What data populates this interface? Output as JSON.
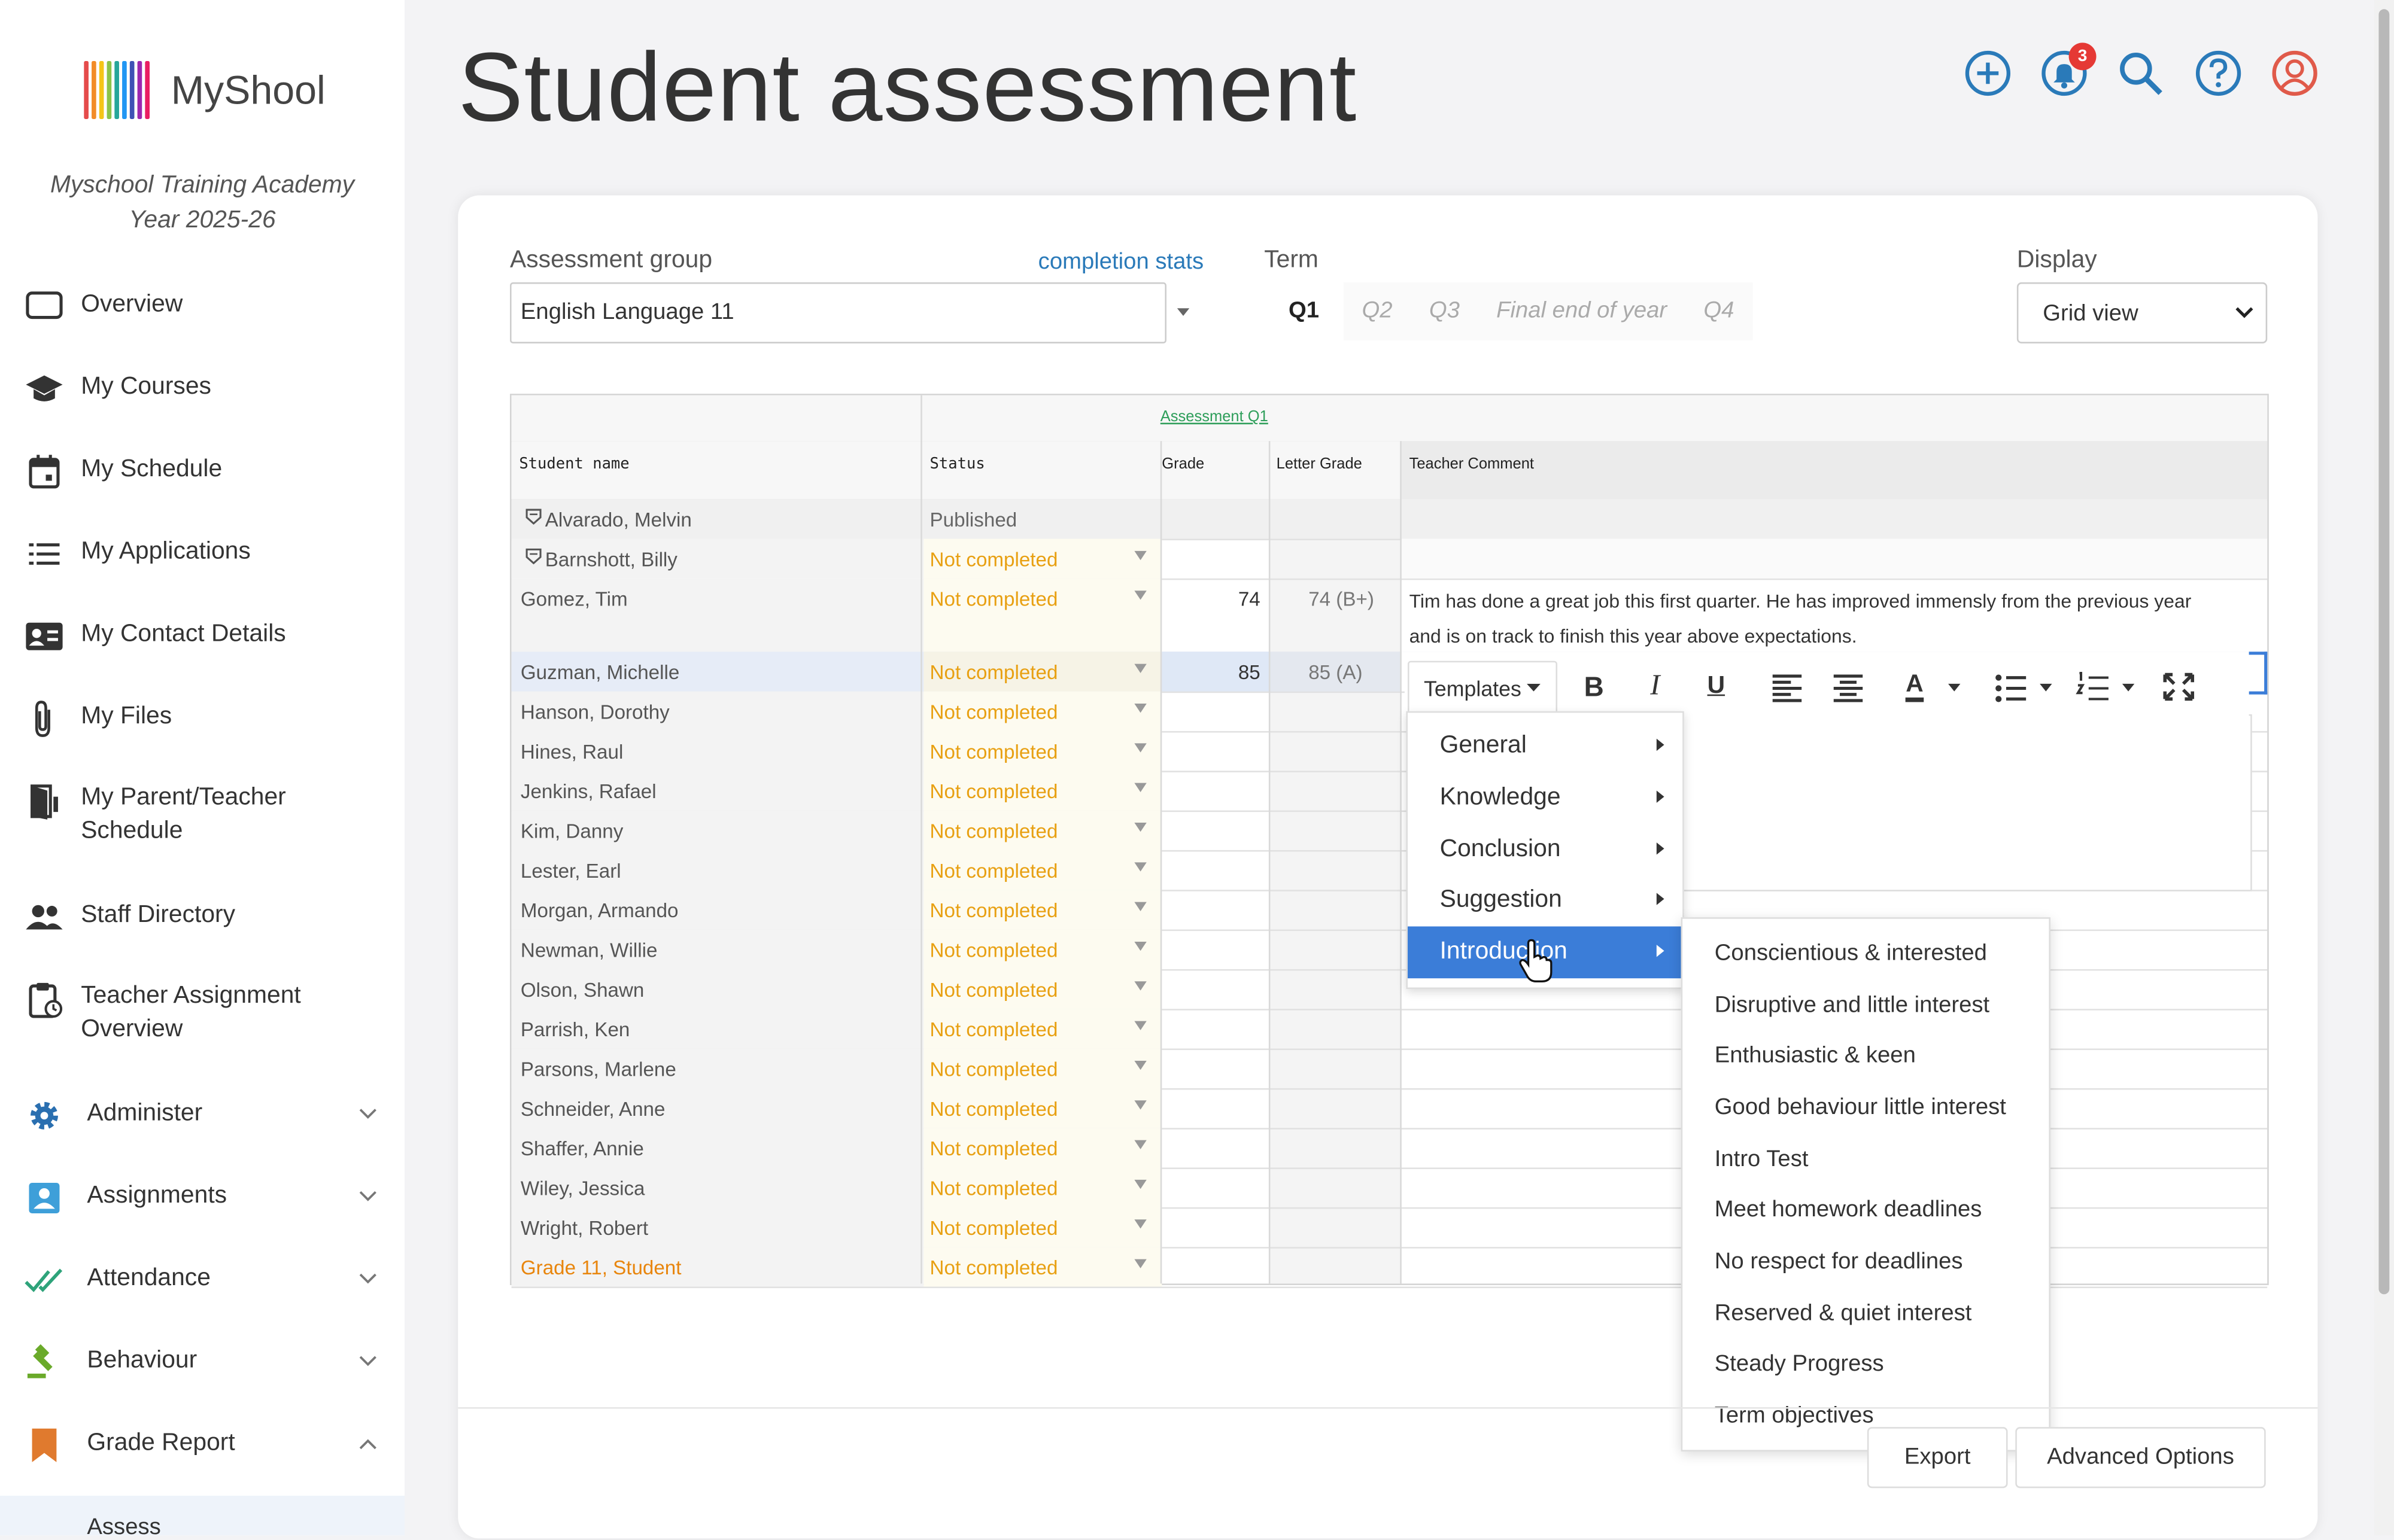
{
  "app": {
    "name": "MyShool",
    "school": "Myschool Training Academy",
    "year": "Year 2025-26"
  },
  "colors": {
    "accent": "#2a7ab9",
    "status": "#e8a012",
    "menu_active": "#3b7dd8",
    "badge": "#e53935",
    "orange_row": "#e8850c"
  },
  "sidebar": {
    "items": [
      {
        "label": "Overview",
        "icon": "monitor-icon"
      },
      {
        "label": "My Courses",
        "icon": "graduation-cap-icon"
      },
      {
        "label": "My Schedule",
        "icon": "calendar-icon"
      },
      {
        "label": "My Applications",
        "icon": "list-icon"
      },
      {
        "label": "My Contact Details",
        "icon": "contact-card-icon"
      },
      {
        "label": "My Files",
        "icon": "paperclip-icon"
      },
      {
        "label": "My Parent/Teacher",
        "label2": "Schedule",
        "icon": "door-icon"
      },
      {
        "label": "Staff Directory",
        "icon": "people-icon"
      },
      {
        "label": "Teacher Assignment",
        "label2": "Overview",
        "icon": "clipboard-icon"
      }
    ],
    "sections": [
      {
        "label": "Administer",
        "icon": "gear-icon"
      },
      {
        "label": "Assignments",
        "icon": "assignment-icon"
      },
      {
        "label": "Attendance",
        "icon": "check-icon"
      },
      {
        "label": "Behaviour",
        "icon": "gavel-icon"
      },
      {
        "label": "Grade Report",
        "icon": "bookmark-icon"
      }
    ],
    "sub_item": "Assess"
  },
  "header": {
    "title": "Student assessment",
    "notification_count": "3",
    "icons": [
      "add-icon",
      "bell-icon",
      "search-icon",
      "help-icon",
      "user-icon"
    ]
  },
  "filters": {
    "group_label": "Assessment group",
    "group_value": "English Language 11",
    "completion_link": "completion stats",
    "term_label": "Term",
    "terms": [
      "Q1",
      "Q2",
      "Q3",
      "Final end of year",
      "Q4"
    ],
    "active_term": "Q1",
    "display_label": "Display",
    "display_value": "Grid view"
  },
  "grid": {
    "group_header": "Assessment Q1",
    "columns": [
      "Student name",
      "Status",
      "Grade",
      "Letter Grade",
      "Teacher Comment"
    ],
    "rows": [
      {
        "name": "Alvarado, Melvin",
        "status": "Published",
        "grade": "",
        "letter": "",
        "comment": "",
        "locked": true
      },
      {
        "name": "Barnshott, Billy",
        "status": "Not completed",
        "grade": "",
        "letter": "",
        "comment": "",
        "locked": true
      },
      {
        "name": "Gomez, Tim",
        "status": "Not completed",
        "grade": "74",
        "letter": "74 (B+)",
        "comment": "Tim has done a great job this first quarter. He has improved immensly from the previous year",
        "comment2": "and is on track to finish this year above expectations."
      },
      {
        "name": "Guzman, Michelle",
        "status": "Not completed",
        "grade": "85",
        "letter": "85 (A)",
        "comment": ""
      },
      {
        "name": "Hanson, Dorothy",
        "status": "Not completed"
      },
      {
        "name": "Hines, Raul",
        "status": "Not completed"
      },
      {
        "name": "Jenkins, Rafael",
        "status": "Not completed"
      },
      {
        "name": "Kim, Danny",
        "status": "Not completed"
      },
      {
        "name": "Lester, Earl",
        "status": "Not completed"
      },
      {
        "name": "Morgan, Armando",
        "status": "Not completed"
      },
      {
        "name": "Newman, Willie",
        "status": "Not completed"
      },
      {
        "name": "Olson, Shawn",
        "status": "Not completed"
      },
      {
        "name": "Parrish, Ken",
        "status": "Not completed"
      },
      {
        "name": "Parsons, Marlene",
        "status": "Not completed"
      },
      {
        "name": "Schneider, Anne",
        "status": "Not completed"
      },
      {
        "name": "Shaffer, Annie",
        "status": "Not completed"
      },
      {
        "name": "Wiley, Jessica",
        "status": "Not completed"
      },
      {
        "name": "Wright, Robert",
        "status": "Not completed"
      },
      {
        "name": "Grade 11, Student",
        "status": "Not completed"
      }
    ]
  },
  "editor": {
    "templates_label": "Templates",
    "toolbar_icons": [
      "bold-icon",
      "italic-icon",
      "underline-icon",
      "align-left-icon",
      "align-center-icon",
      "font-color-icon",
      "bullet-list-icon",
      "numbered-list-icon",
      "fullscreen-icon"
    ],
    "menu": [
      "General",
      "Knowledge",
      "Conclusion",
      "Suggestion",
      "Introduction"
    ],
    "active_menu": "Introduction",
    "submenu": [
      "Conscientious & interested",
      "Disruptive and little interest",
      "Enthusiastic & keen",
      "Good behaviour little interest",
      "Intro Test",
      "Meet homework deadlines",
      "No respect for deadlines",
      "Reserved & quiet interest",
      "Steady Progress",
      "Term objectives"
    ]
  },
  "footer": {
    "export": "Export",
    "advanced": "Advanced Options"
  }
}
